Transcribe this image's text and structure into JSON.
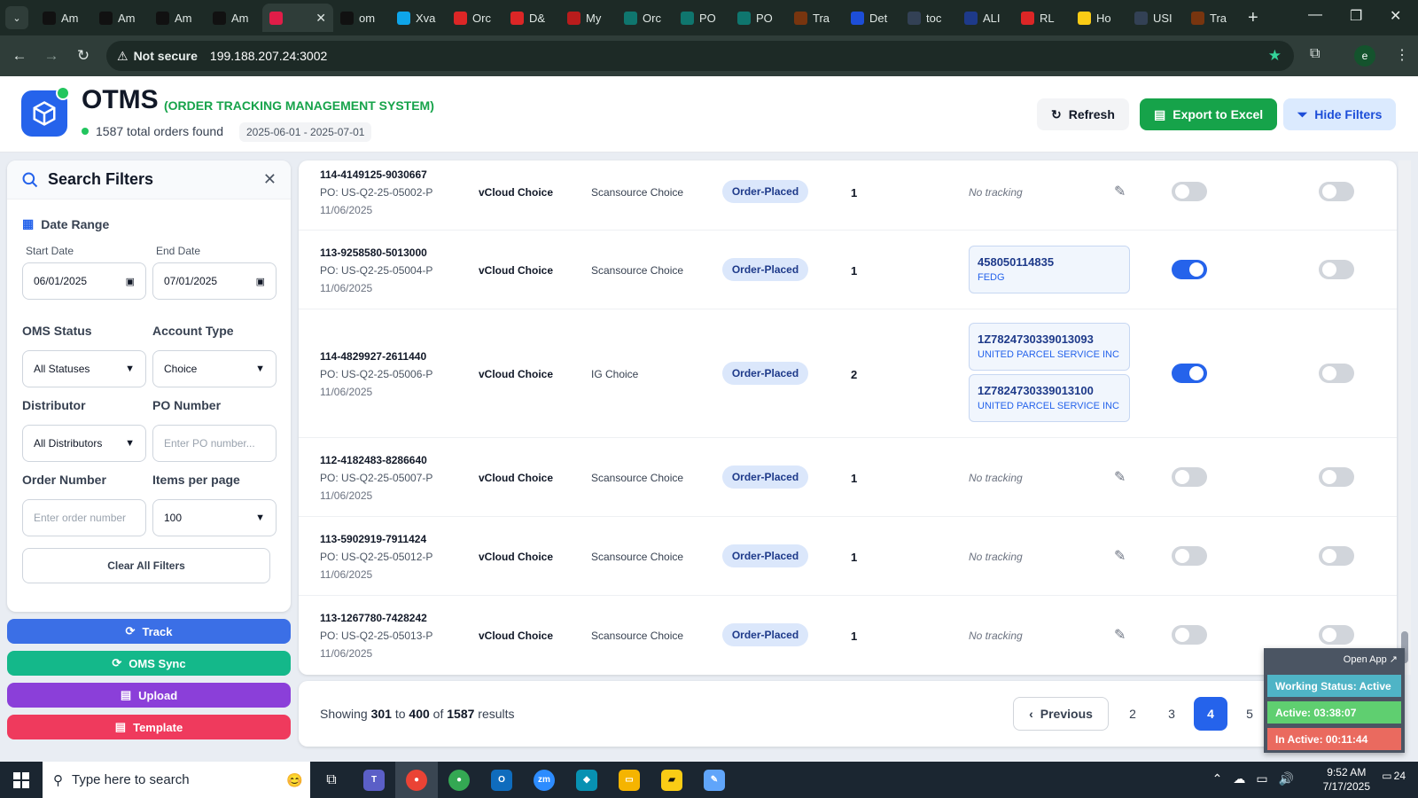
{
  "browser": {
    "tabs": [
      {
        "label": "Am",
        "icon": "amazon-icon",
        "color": "#111"
      },
      {
        "label": "Am",
        "icon": "amazon-icon",
        "color": "#111"
      },
      {
        "label": "Am",
        "icon": "amazon-icon",
        "color": "#111"
      },
      {
        "label": "Am",
        "icon": "amazon-icon",
        "color": "#111"
      },
      {
        "label": "",
        "icon": "otms-icon",
        "color": "#e11d48"
      },
      {
        "label": "om",
        "icon": "om-icon",
        "color": "#111"
      },
      {
        "label": "Xva",
        "icon": "xva-icon",
        "color": "#0ea5e9"
      },
      {
        "label": "Orc",
        "icon": "orc-icon",
        "color": "#dc2626"
      },
      {
        "label": "D&",
        "icon": "dnh-icon",
        "color": "#dc2626"
      },
      {
        "label": "My",
        "icon": "my-icon",
        "color": "#b91c1c"
      },
      {
        "label": "Orc",
        "icon": "ec-icon",
        "color": "#0f766e"
      },
      {
        "label": "PO",
        "icon": "ec-icon",
        "color": "#0f766e"
      },
      {
        "label": "PO",
        "icon": "ec-icon",
        "color": "#0f766e"
      },
      {
        "label": "Tra",
        "icon": "ups-icon",
        "color": "#78350f"
      },
      {
        "label": "Det",
        "icon": "flag-icon",
        "color": "#1d4ed8"
      },
      {
        "label": "toc",
        "icon": "doc-icon",
        "color": "#334155"
      },
      {
        "label": "ALI",
        "icon": "ali-icon",
        "color": "#1e3a8a"
      },
      {
        "label": "RL",
        "icon": "rl-icon",
        "color": "#dc2626"
      },
      {
        "label": "Ho",
        "icon": "ho-icon",
        "color": "#facc15"
      },
      {
        "label": "USI",
        "icon": "doc-icon",
        "color": "#334155"
      },
      {
        "label": "Tra",
        "icon": "ups-icon",
        "color": "#78350f"
      }
    ],
    "not_secure": "Not secure",
    "url": "199.188.207.24:3002",
    "profile": "e"
  },
  "header": {
    "title": "OTMS",
    "subtitle": "(ORDER TRACKING MANAGEMENT SYSTEM)",
    "total": "1587 total orders found",
    "date_range": "2025-06-01 - 2025-07-01",
    "refresh": "Refresh",
    "export": "Export to Excel",
    "hide_filters": "Hide Filters"
  },
  "filters": {
    "title": "Search Filters",
    "date_range": "Date Range",
    "start_label": "Start Date",
    "start_value": "06/01/2025",
    "end_label": "End Date",
    "end_value": "07/01/2025",
    "oms_status_label": "OMS Status",
    "oms_status_value": "All Statuses",
    "account_type_label": "Account Type",
    "account_type_value": "Choice",
    "distributor_label": "Distributor",
    "distributor_value": "All Distributors",
    "po_label": "PO Number",
    "po_placeholder": "Enter PO number...",
    "order_label": "Order Number",
    "order_placeholder": "Enter order number",
    "items_label": "Items per page",
    "items_value": "100",
    "clear": "Clear All Filters"
  },
  "actions": {
    "track": "Track",
    "oms_sync": "OMS Sync",
    "upload": "Upload",
    "template": "Template"
  },
  "orders": [
    {
      "order_id": "114-4149125-9030667",
      "po": "PO: US-Q2-25-05002-P",
      "date": "11/06/2025",
      "account": "vCloud Choice",
      "distributor": "Scansource Choice",
      "status": "Order-Placed",
      "qty": "1",
      "no_tracking": "No tracking",
      "tracking": [],
      "toggle1": false,
      "toggle2": false
    },
    {
      "order_id": "113-9258580-5013000",
      "po": "PO: US-Q2-25-05004-P",
      "date": "11/06/2025",
      "account": "vCloud Choice",
      "distributor": "Scansource Choice",
      "status": "Order-Placed",
      "qty": "1",
      "no_tracking": "",
      "tracking": [
        {
          "number": "458050114835",
          "carrier": "FEDG"
        }
      ],
      "toggle1": true,
      "toggle2": false
    },
    {
      "order_id": "114-4829927-2611440",
      "po": "PO: US-Q2-25-05006-P",
      "date": "11/06/2025",
      "account": "vCloud Choice",
      "distributor": "IG Choice",
      "status": "Order-Placed",
      "qty": "2",
      "no_tracking": "",
      "tracking": [
        {
          "number": "1Z7824730339013093",
          "carrier": "UNITED PARCEL SERVICE INC"
        },
        {
          "number": "1Z7824730339013100",
          "carrier": "UNITED PARCEL SERVICE INC"
        }
      ],
      "toggle1": true,
      "toggle2": false
    },
    {
      "order_id": "112-4182483-8286640",
      "po": "PO: US-Q2-25-05007-P",
      "date": "11/06/2025",
      "account": "vCloud Choice",
      "distributor": "Scansource Choice",
      "status": "Order-Placed",
      "qty": "1",
      "no_tracking": "No tracking",
      "tracking": [],
      "toggle1": false,
      "toggle2": false
    },
    {
      "order_id": "113-5902919-7911424",
      "po": "PO: US-Q2-25-05012-P",
      "date": "11/06/2025",
      "account": "vCloud Choice",
      "distributor": "Scansource Choice",
      "status": "Order-Placed",
      "qty": "1",
      "no_tracking": "No tracking",
      "tracking": [],
      "toggle1": false,
      "toggle2": false
    },
    {
      "order_id": "113-1267780-7428242",
      "po": "PO: US-Q2-25-05013-P",
      "date": "11/06/2025",
      "account": "vCloud Choice",
      "distributor": "Scansource Choice",
      "status": "Order-Placed",
      "qty": "1",
      "no_tracking": "No tracking",
      "tracking": [],
      "toggle1": false,
      "toggle2": false
    }
  ],
  "pagination": {
    "showing_prefix": "Showing",
    "from": "301",
    "to_word": "to",
    "to": "400",
    "of_word": "of",
    "total": "1587",
    "results_word": "results",
    "previous": "Previous",
    "pages": [
      "2",
      "3",
      "4",
      "5"
    ],
    "current": "4"
  },
  "widget": {
    "open_app": "Open App ↗",
    "working_status": "Working Status: Active",
    "active": "Active: 03:38:07",
    "inactive": "In Active: 00:11:44"
  },
  "taskbar": {
    "search_placeholder": "Type here to search",
    "time": "9:52 AM",
    "date": "7/17/2025",
    "notifications": "24"
  },
  "colors": {
    "primary": "#2563eb",
    "success": "#16a34a",
    "track": "#3b6fe6",
    "oms_sync": "#14b88a",
    "upload": "#8b3fd9",
    "template": "#ef3a5d"
  }
}
